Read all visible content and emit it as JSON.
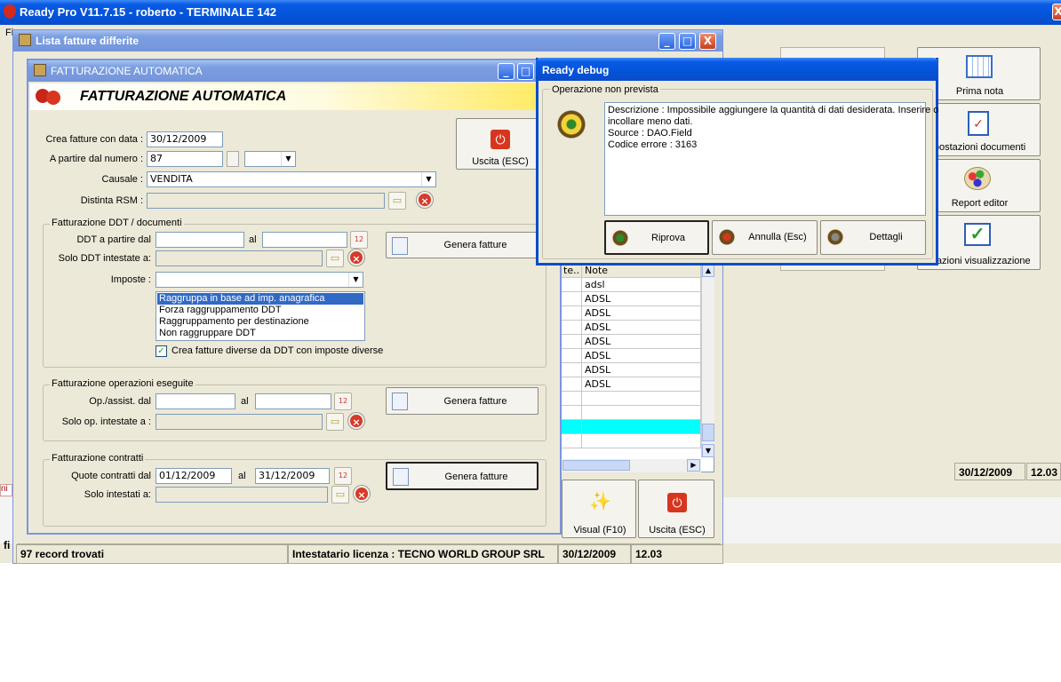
{
  "app": {
    "title": "Ready Pro V11.7.15 - roberto - TERMINALE 142",
    "menu_first": "Fi",
    "left_fragments": [
      "ni",
      "fi"
    ],
    "status": {
      "records": "97 record trovati",
      "license": "Intestatario licenza : TECNO WORLD GROUP SRL",
      "date": "30/12/2009",
      "time": "12.03"
    }
  },
  "right_panel": {
    "buttons": [
      {
        "label": "Prima nota",
        "icon": "calendar-icon"
      },
      {
        "label": "postazioni documenti",
        "icon": "checklist-icon"
      },
      {
        "label": "Report editor",
        "icon": "palette-icon"
      },
      {
        "label": "stazioni visualizzazione",
        "icon": "checkmark-icon"
      }
    ],
    "status_date": "30/12/2009",
    "status_time": "12.03"
  },
  "lista_window": {
    "title": "Lista fatture differite",
    "grid": {
      "col_partial": "te..",
      "col_note": "Note",
      "rows": [
        "adsl",
        "ADSL",
        "ADSL",
        "ADSL",
        "ADSL",
        "ADSL",
        "ADSL",
        "ADSL",
        "",
        "",
        "",
        ""
      ]
    },
    "btn_visual": "Visual (F10)",
    "btn_uscita": "Uscita (ESC)"
  },
  "fatt_window": {
    "title": "FATTURAZIONE AUTOMATICA",
    "header": "FATTURAZIONE AUTOMATICA",
    "crea_label": "Crea fatture con data :",
    "crea_value": "30/12/2009",
    "numero_label": "A partire dal numero :",
    "numero_value": "87",
    "causale_label": "Causale :",
    "causale_value": "VENDITA",
    "distinta_label": "Distinta RSM :",
    "uscita": "Uscita (ESC)",
    "ddt_group": {
      "title": "Fatturazione DDT / documenti",
      "from_label": "DDT a partire dal",
      "al": "al",
      "solo_label": "Solo DDT intestate a:",
      "imposte_label": "Imposte :",
      "genera": "Genera fatture",
      "list": [
        "Raggruppa in base ad imp. anagrafica",
        "Forza raggruppamento DDT",
        "Raggruppamento per destinazione",
        "Non raggruppare DDT"
      ],
      "checkbox_label": "Crea fatture diverse da DDT con imposte diverse",
      "checkbox_checked": true
    },
    "op_group": {
      "title": "Fatturazione operazioni eseguite",
      "from_label": "Op./assist. dal",
      "al": "al",
      "solo_label": "Solo op. intestate a :",
      "genera": "Genera fatture"
    },
    "contr_group": {
      "title": "Fatturazione contratti",
      "from_label": "Quote contratti dal",
      "from_value": "01/12/2009",
      "al": "al",
      "to_value": "31/12/2009",
      "solo_label": "Solo intestati a:",
      "genera": "Genera fatture"
    }
  },
  "debug_dialog": {
    "title": "Ready debug",
    "group": "Operazione non prevista",
    "message_lines": [
      "Descrizione : Impossibile aggiungere la quantità di dati desiderata. Inserire o",
      "incollare meno dati.",
      "Source : DAO.Field",
      "Codice errore : 3163"
    ],
    "btn_riprova": "Riprova",
    "btn_annulla": "Annulla (Esc)",
    "btn_dettagli": "Dettagli"
  },
  "colors": {
    "xp_blue": "#0354d8",
    "panel": "#ece9d8",
    "selection": "#316ac5",
    "cyan_row": "#00ffff"
  }
}
